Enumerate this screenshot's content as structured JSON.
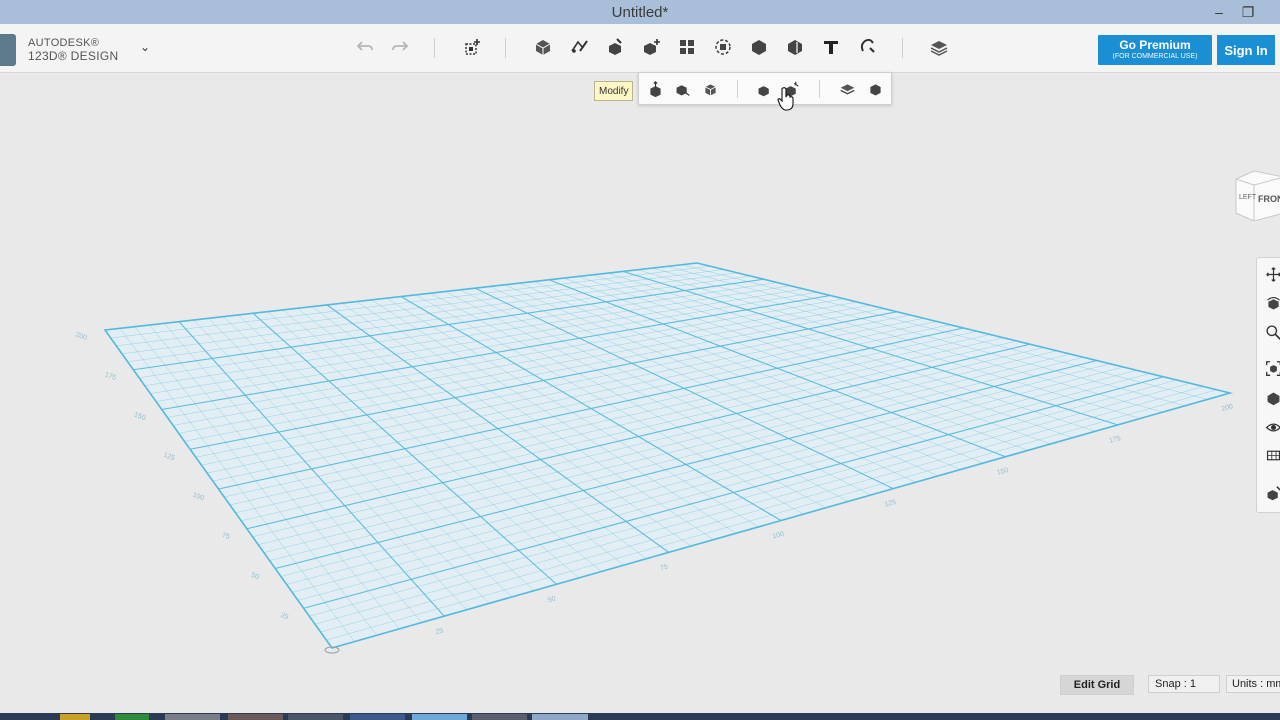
{
  "window": {
    "title": "Untitled*",
    "minimize_glyph": "–",
    "maximize_glyph": "❐"
  },
  "brand": {
    "line1": "AUTODESK®",
    "line2": "123D® DESIGN",
    "menu_chevron": "⌄"
  },
  "toolbar": {
    "icons": [
      "undo-icon",
      "redo-icon",
      "transform-icon",
      "primitives-icon",
      "sketch-icon",
      "construct-icon",
      "modify-icon",
      "pattern-icon",
      "grouping-icon",
      "combine-icon",
      "measure-icon",
      "text-icon",
      "snap-icon",
      "material-icon"
    ]
  },
  "account": {
    "premium_label": "Go Premium",
    "premium_sublabel": "(FOR COMMERCIAL USE)",
    "signin_label": "Sign In"
  },
  "tooltip": {
    "label": "Modify"
  },
  "modify_menu": {
    "icons": [
      "press-pull-icon",
      "tweak-icon",
      "split-face-icon",
      "fillet-icon",
      "chamfer-icon",
      "split-solid-icon",
      "shell-icon"
    ]
  },
  "grid": {
    "left_labels": [
      "200",
      "175",
      "150",
      "125",
      "100",
      "75",
      "50",
      "25"
    ],
    "bottom_labels": [
      "25",
      "50",
      "75",
      "100",
      "125",
      "150",
      "175",
      "200"
    ],
    "line_color": "#53b9df",
    "fill_color": "#e2eef3"
  },
  "viewcube": {
    "left_face": "LEFT",
    "front_face": "FRONT"
  },
  "navbar": {
    "icons": [
      "pan-icon",
      "orbit-icon",
      "zoom-icon",
      "fit-icon",
      "perspective-icon",
      "visibility-icon",
      "material-view-icon",
      "solid-view-icon"
    ]
  },
  "status": {
    "edit_grid": "Edit Grid",
    "snap": "Snap  :  1",
    "units": "Units : mm"
  },
  "colors": {
    "accent": "#1b8fd3",
    "titlebar": "#a9bfd9"
  }
}
